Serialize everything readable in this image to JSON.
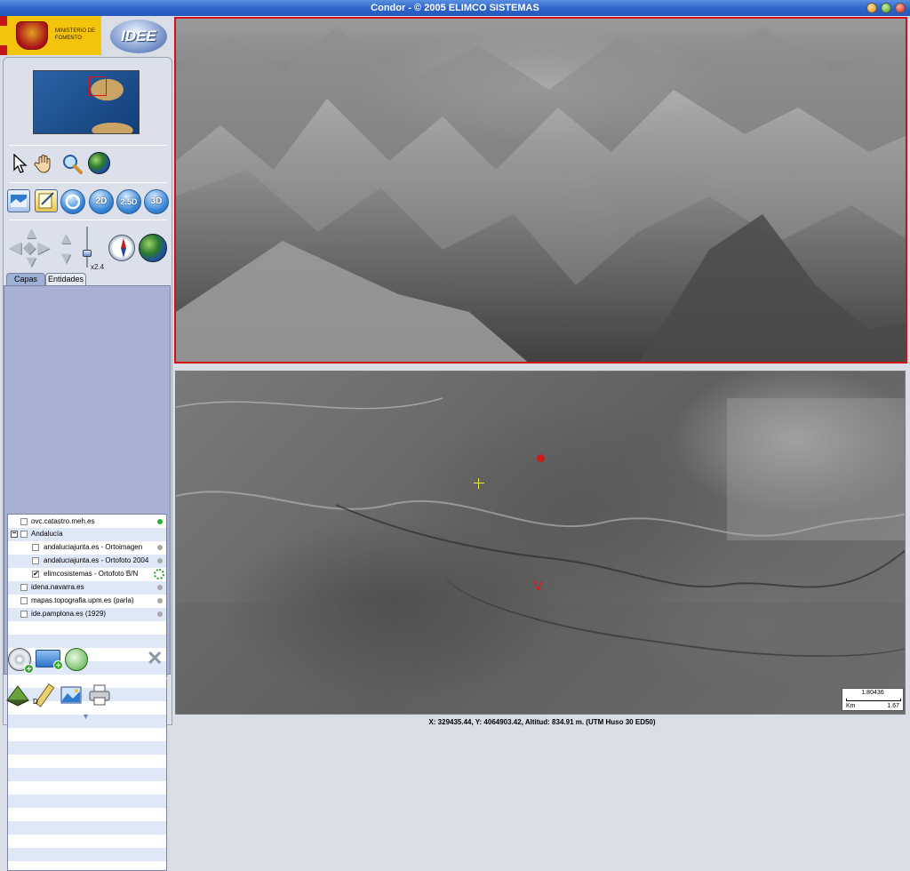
{
  "window": {
    "title": "Condor - © 2005 ELIMCO SISTEMAS"
  },
  "logos": {
    "ministerio_text": "MINISTERIO DE FOMENTO",
    "idee_text": "IDEE"
  },
  "toolbar": {
    "tools": [
      {
        "icon": "pointer-arrow-icon"
      },
      {
        "icon": "pan-hand-icon"
      },
      {
        "icon": "zoom-magnifier-icon"
      },
      {
        "icon": "globe-icon"
      }
    ],
    "view_buttons": {
      "label_2d": "2D",
      "label_25d": "2.5D",
      "label_3d": "3D"
    },
    "zoom_level": "x2.4"
  },
  "tabs": [
    {
      "label": "Capas",
      "active": true
    },
    {
      "label": "Entidades",
      "active": false
    }
  ],
  "layers": [
    {
      "label": "ovc.catastro.meh.es",
      "checked": false,
      "status": "active"
    },
    {
      "label": "Andalucía",
      "checked": false,
      "group": true,
      "expander": "−"
    },
    {
      "label": "andaluciajunta.es - Ortoimagen",
      "checked": false,
      "status": "inactive"
    },
    {
      "label": "andaluciajunta.es - Ortofoto 2004",
      "checked": false,
      "status": "inactive"
    },
    {
      "label": "elimcosistemas - Ortofoto B/N",
      "checked": true,
      "status": "loading"
    },
    {
      "label": "idena.navarra.es",
      "checked": false,
      "status": "inactive"
    },
    {
      "label": "mapas.topografia.upm.es (parla)",
      "checked": false,
      "status": "inactive"
    },
    {
      "label": "ide.pamplona.es (1929)",
      "checked": false,
      "status": "inactive"
    }
  ],
  "map": {
    "scale_ratio": "1:80436",
    "scale_unit": "Km",
    "scale_distance": "1.67",
    "camera_marker": "V"
  },
  "status": {
    "coordinates": "X: 329435.44, Y: 4064903.42, Altitud: 834.91 m. (UTM Huso 30 ED50)"
  },
  "colors": {
    "titlebar": "#2d63c8",
    "view3d_border": "#d0101a",
    "panel_bg": "#dce0ea",
    "active_dot": "#2ab22a"
  }
}
